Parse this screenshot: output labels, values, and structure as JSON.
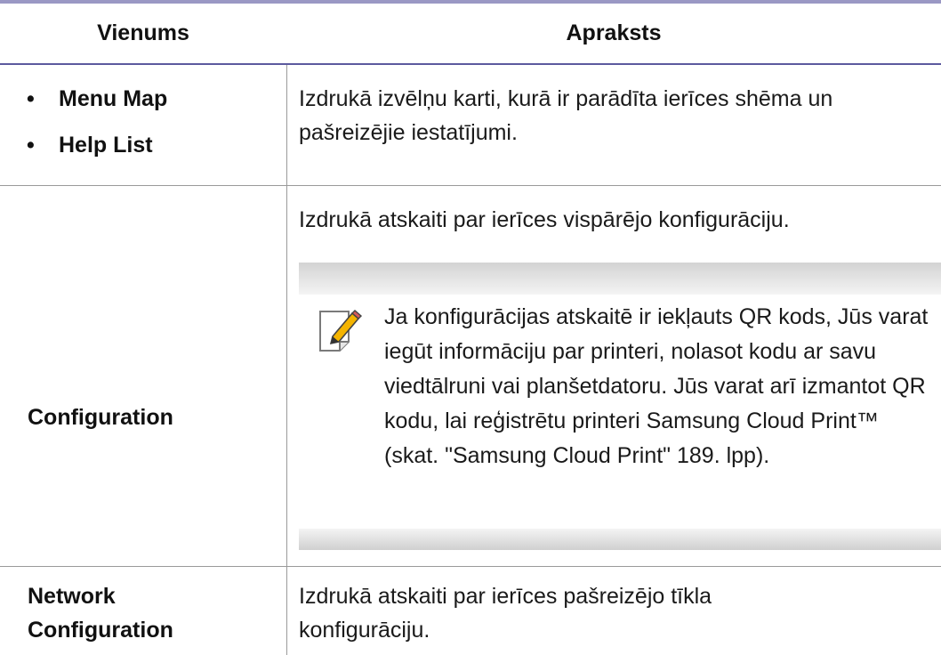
{
  "header": {
    "col1": "Vienums",
    "col2": "Apraksts"
  },
  "rows": [
    {
      "items": [
        "Menu Map",
        "Help List"
      ],
      "description": "Izdrukā izvēlņu karti, kurā ir parādīta ierīces shēma un pašreizējie iestatījumi."
    },
    {
      "item": "Configuration",
      "description": "Izdrukā atskaiti par ierīces vispārējo konfigurāciju.",
      "note": "Ja konfigurācijas atskaitē ir iekļauts QR kods, Jūs varat iegūt informāciju par printeri, nolasot kodu ar savu viedtālruni vai planšetdatoru. Jūs varat arī izmantot QR kodu, lai reģistrētu printeri Samsung Cloud Print™ (skat. \"Samsung Cloud Print\" 189. lpp)."
    },
    {
      "item": "Network Configuration",
      "description": "Izdrukā atskaiti par ierīces pašreizējo tīkla konfigurāciju."
    }
  ],
  "icons": {
    "note": "note-pencil-icon"
  },
  "colors": {
    "header_rule": "#5c5a9e",
    "top_rule": "#9a98c4",
    "note_band": "#d3d3d3",
    "icon_accent": "#f4b400"
  }
}
